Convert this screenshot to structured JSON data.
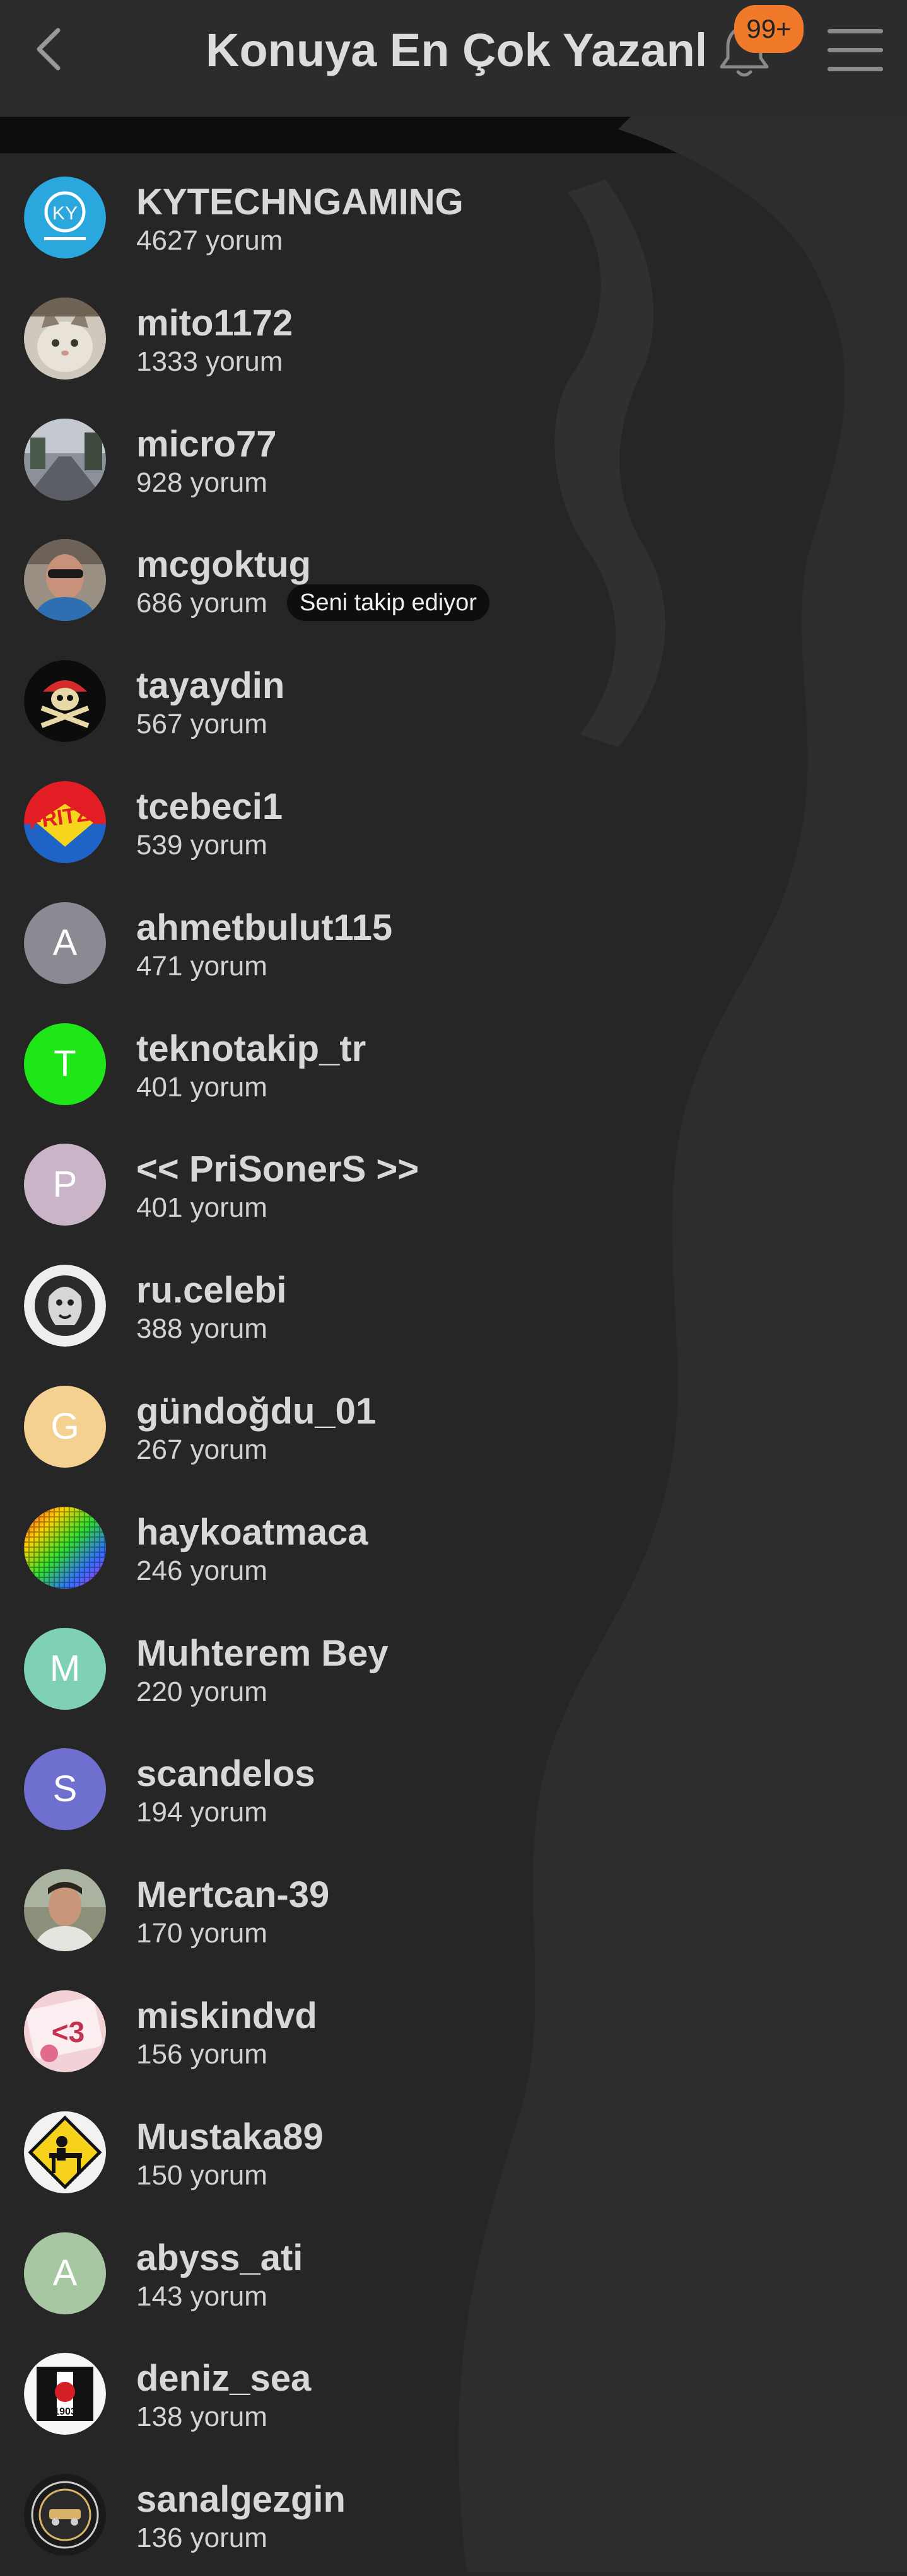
{
  "header": {
    "title": "Konuya En Çok Yazanl..",
    "badge": "99+",
    "back_icon": "chevron-left-icon",
    "bell_icon": "bell-icon",
    "menu_icon": "hamburger-menu-icon"
  },
  "users": [
    {
      "name": "KYTECHNGAMING",
      "count": "4627 yorum",
      "avatar": {
        "type": "image",
        "icon": "ky-tech-gaming-logo"
      }
    },
    {
      "name": "mito1172",
      "count": "1333 yorum",
      "avatar": {
        "type": "image",
        "icon": "cat-photo"
      }
    },
    {
      "name": "micro77",
      "count": "928 yorum",
      "avatar": {
        "type": "image",
        "icon": "street-photo"
      }
    },
    {
      "name": "mcgoktug",
      "count": "686 yorum",
      "badge": "Seni takip ediyor",
      "avatar": {
        "type": "image",
        "icon": "person-photo"
      }
    },
    {
      "name": "tayaydin",
      "count": "567 yorum",
      "avatar": {
        "type": "image",
        "icon": "pirate-skull"
      }
    },
    {
      "name": "tcebeci1",
      "count": "539 yorum",
      "avatar": {
        "type": "image",
        "icon": "fritz-logo"
      }
    },
    {
      "name": "ahmetbulut115",
      "count": "471 yorum",
      "avatar": {
        "type": "letter",
        "letter": "A",
        "color": "#8a8a93"
      }
    },
    {
      "name": "teknotakip_tr",
      "count": "401 yorum",
      "avatar": {
        "type": "letter",
        "letter": "T",
        "color": "#1ee619"
      }
    },
    {
      "name": "<< PriSonerS >>",
      "count": "401 yorum",
      "avatar": {
        "type": "letter",
        "letter": "P",
        "color": "#c9b5c7"
      }
    },
    {
      "name": "ru.celebi",
      "count": "388 yorum",
      "avatar": {
        "type": "image",
        "icon": "lion-logo"
      }
    },
    {
      "name": "gündoğdu_01",
      "count": "267 yorum",
      "avatar": {
        "type": "letter",
        "letter": "G",
        "color": "#f4d091"
      }
    },
    {
      "name": "haykoatmaca",
      "count": "246 yorum",
      "avatar": {
        "type": "image",
        "icon": "color-grid"
      }
    },
    {
      "name": "Muhterem Bey",
      "count": "220 yorum",
      "avatar": {
        "type": "letter",
        "letter": "M",
        "color": "#7fd1b3"
      }
    },
    {
      "name": "scandelos",
      "count": "194 yorum",
      "avatar": {
        "type": "letter",
        "letter": "S",
        "color": "#6f6fd0"
      }
    },
    {
      "name": "Mertcan-39",
      "count": "170 yorum",
      "avatar": {
        "type": "image",
        "icon": "man-photo"
      }
    },
    {
      "name": "miskindvd",
      "count": "156 yorum",
      "avatar": {
        "type": "image",
        "icon": "heart-3-sticker"
      }
    },
    {
      "name": "Mustaka89",
      "count": "150 yorum",
      "avatar": {
        "type": "image",
        "icon": "desk-sign"
      }
    },
    {
      "name": "abyss_ati",
      "count": "143 yorum",
      "avatar": {
        "type": "letter",
        "letter": "A",
        "color": "#a7c7a3"
      }
    },
    {
      "name": "deniz_sea",
      "count": "138 yorum",
      "avatar": {
        "type": "image",
        "icon": "bjk-logo"
      }
    },
    {
      "name": "sanalgezgin",
      "count": "136 yorum",
      "avatar": {
        "type": "image",
        "icon": "emblem-logo"
      }
    }
  ]
}
